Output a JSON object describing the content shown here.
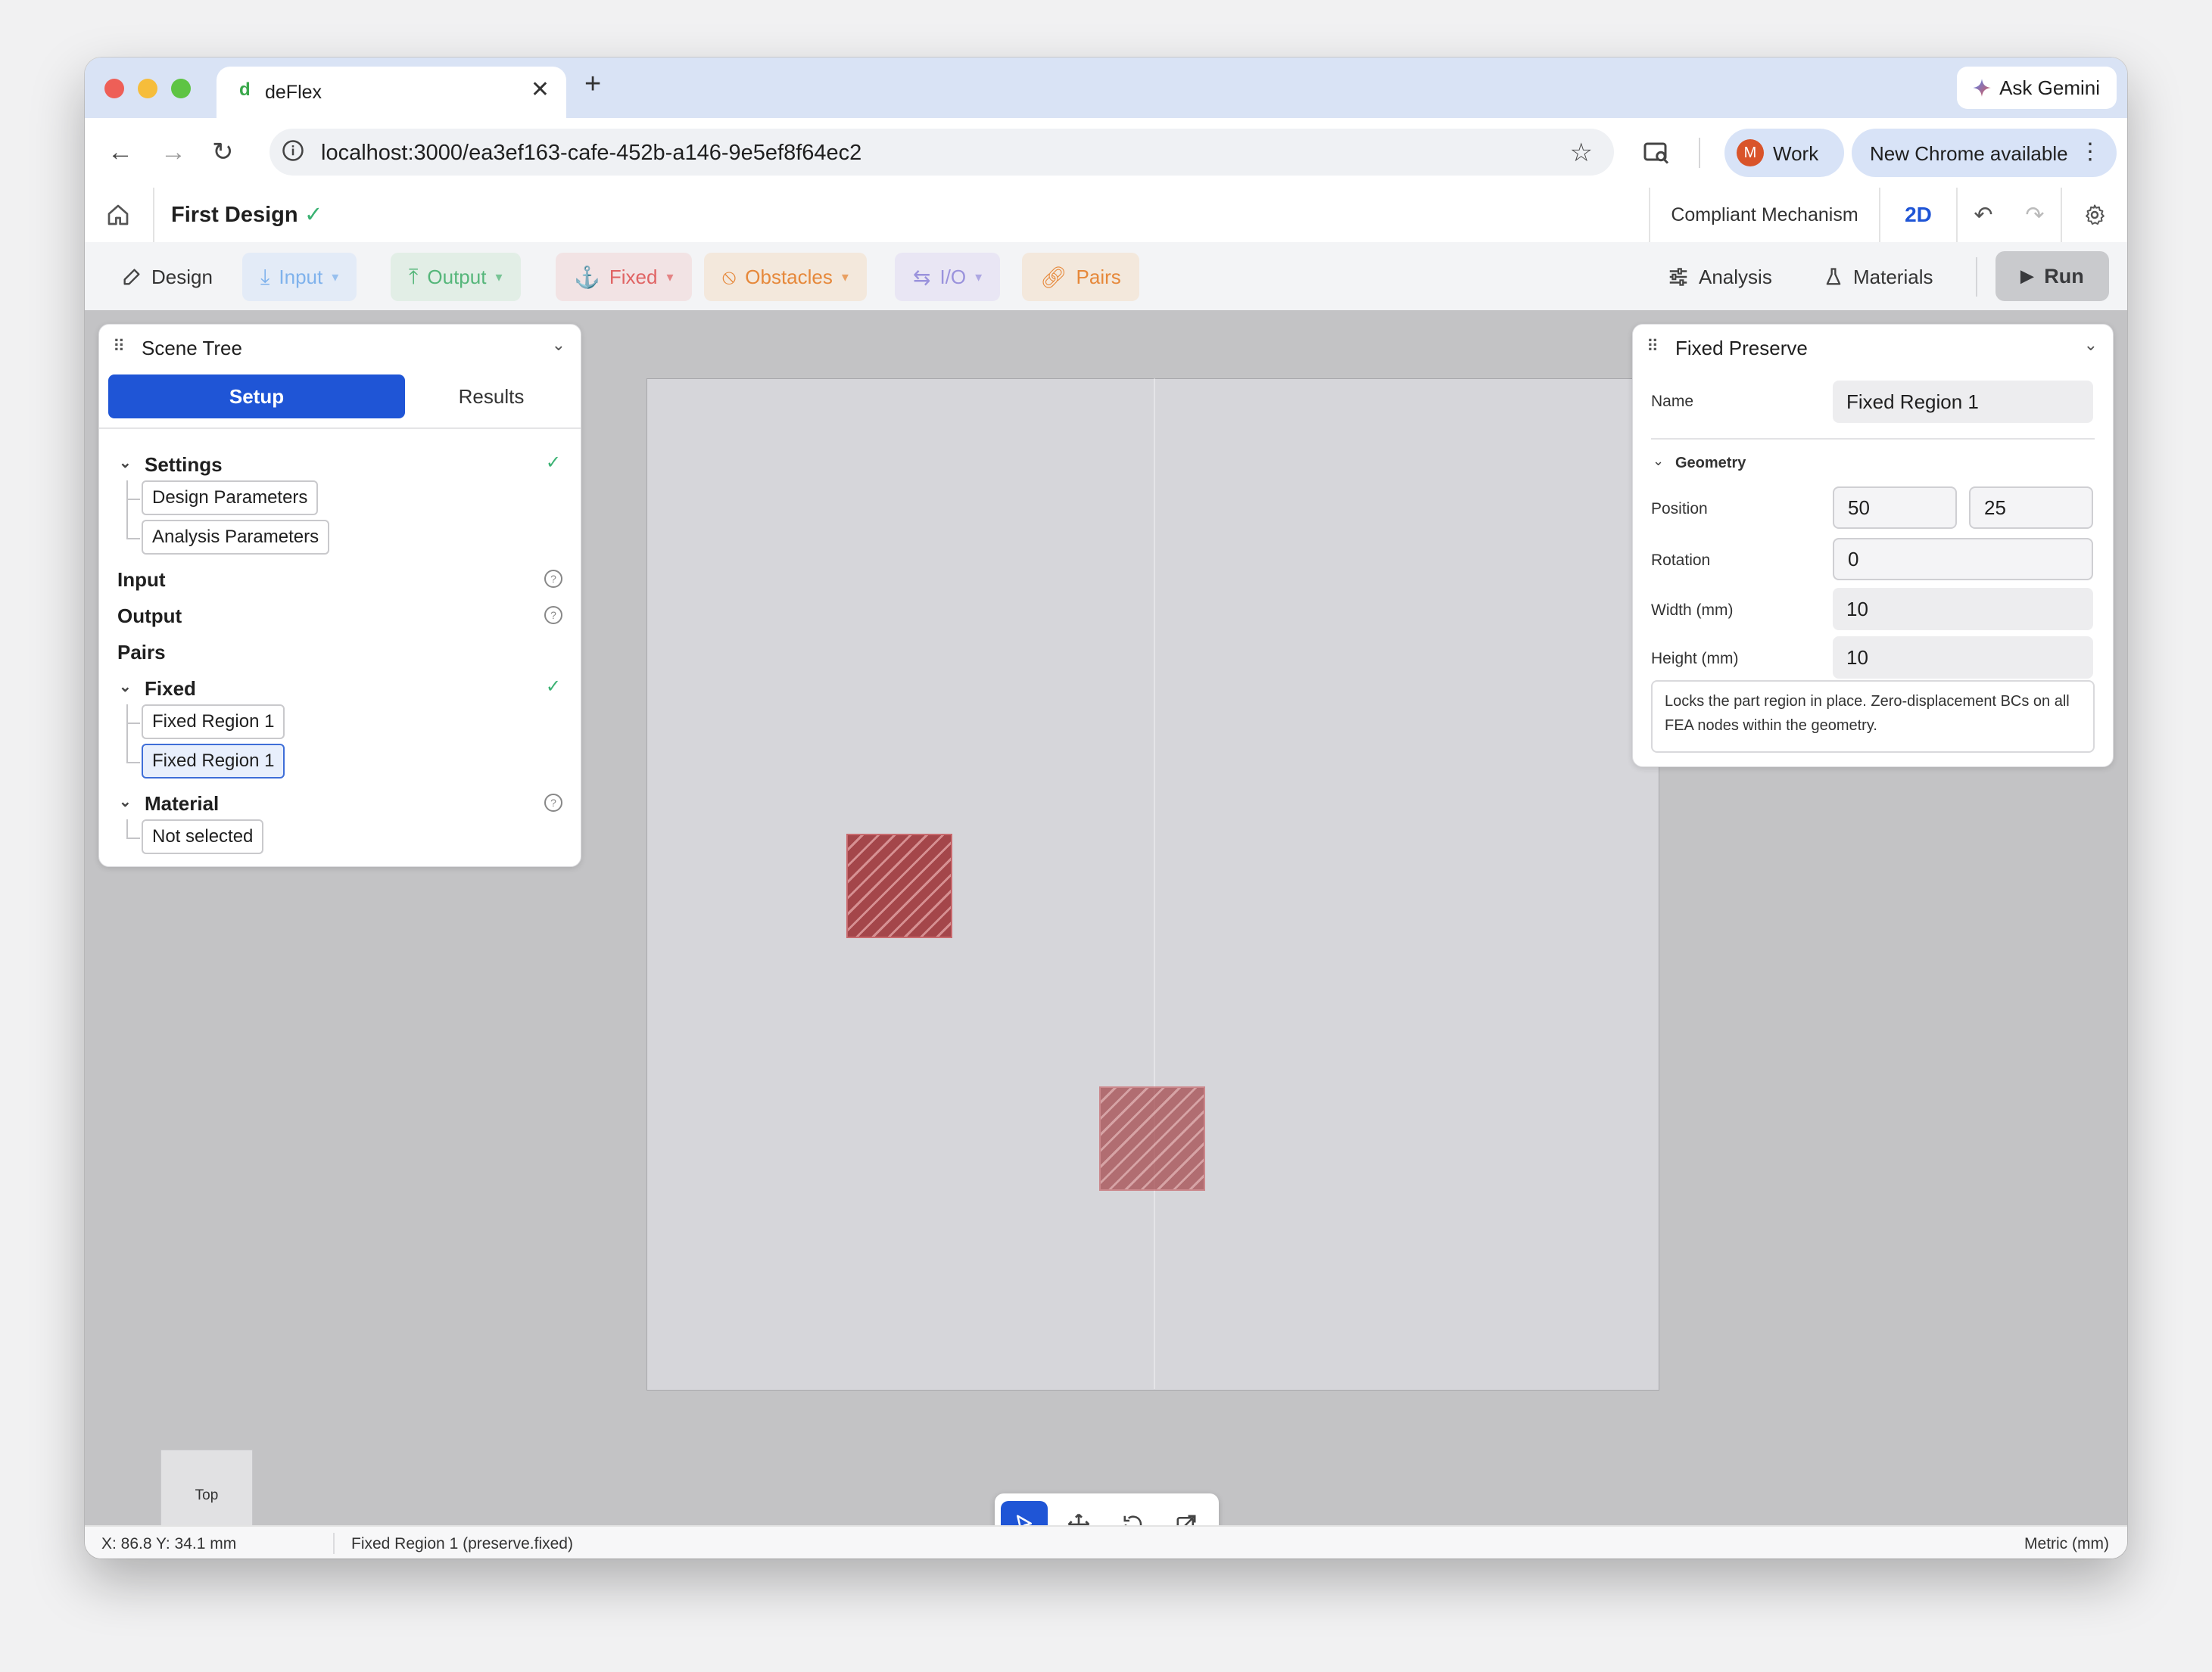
{
  "browser": {
    "tab_title": "deFlex",
    "favicon_letter": "d",
    "url": "localhost:3000/ea3ef163-cafe-452b-a146-9e5ef8f64ec2",
    "gemini_label": "Ask Gemini",
    "profile_initial": "M",
    "profile_label": "Work",
    "update_label": "New Chrome available"
  },
  "header": {
    "design_name": "First Design",
    "mode_label": "Compliant Mechanism",
    "view_label": "2D"
  },
  "toolbar": {
    "design": "Design",
    "input": "Input",
    "output": "Output",
    "fixed": "Fixed",
    "obstacles": "Obstacles",
    "io": "I/O",
    "pairs": "Pairs",
    "analysis": "Analysis",
    "materials": "Materials",
    "run": "Run"
  },
  "colors": {
    "input": "#7fb2ec",
    "output": "#55b67a",
    "fixed": "#e06464",
    "obstacles": "#e6883a",
    "io": "#9a92dc",
    "pairs": "#e6883a",
    "accent": "#1f55d6",
    "region": "#a4464a"
  },
  "scene_tree": {
    "title": "Scene Tree",
    "tab_setup": "Setup",
    "tab_results": "Results",
    "settings": "Settings",
    "design_parameters": "Design Parameters",
    "analysis_parameters": "Analysis Parameters",
    "input": "Input",
    "output": "Output",
    "pairs": "Pairs",
    "fixed": "Fixed",
    "fixed_items": [
      "Fixed Region 1",
      "Fixed Region 1"
    ],
    "material": "Material",
    "material_value": "Not selected"
  },
  "properties": {
    "title": "Fixed Preserve",
    "name_label": "Name",
    "name_value": "Fixed Region 1",
    "geometry_label": "Geometry",
    "position_label": "Position",
    "position_x": "50",
    "position_y": "25",
    "rotation_label": "Rotation",
    "rotation_value": "0",
    "width_label": "Width (mm)",
    "width_value": "10",
    "height_label": "Height (mm)",
    "height_value": "10",
    "description": "Locks the part region in place. Zero-displacement BCs on all FEA nodes within the geometry."
  },
  "viewport": {
    "view_cube_label": "Top"
  },
  "statusbar": {
    "coords": "X: 86.8 Y: 34.1 mm",
    "selection": "Fixed Region 1 (preserve.fixed)",
    "units": "Metric (mm)"
  }
}
